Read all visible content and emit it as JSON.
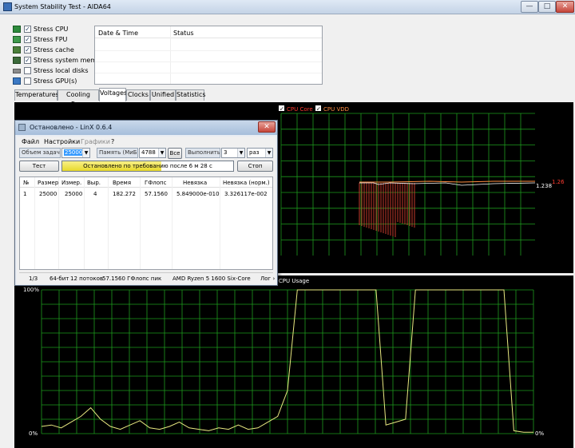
{
  "window": {
    "title": "System Stability Test - AIDA64",
    "minimize": "—",
    "maximize": "□",
    "close": "✕"
  },
  "stress_options": [
    {
      "label": "Stress CPU",
      "checked": true,
      "icon": "cpu-icon"
    },
    {
      "label": "Stress FPU",
      "checked": true,
      "icon": "fpu-icon"
    },
    {
      "label": "Stress cache",
      "checked": true,
      "icon": "cache-icon"
    },
    {
      "label": "Stress system memory",
      "checked": true,
      "icon": "memory-icon"
    },
    {
      "label": "Stress local disks",
      "checked": false,
      "icon": "disk-icon"
    },
    {
      "label": "Stress GPU(s)",
      "checked": false,
      "icon": "gpu-icon"
    }
  ],
  "log": {
    "columns": [
      "Date & Time",
      "Status"
    ]
  },
  "tabs": [
    "Temperatures",
    "Cooling Fans",
    "Voltages",
    "Clocks",
    "Unified",
    "Statistics"
  ],
  "active_tab": "Voltages",
  "voltage_chart": {
    "legend": [
      {
        "label": "CPU Core",
        "color": "#ff3b30",
        "checked": true
      },
      {
        "label": "CPU VDD",
        "color": "#ff8c40",
        "checked": true
      }
    ],
    "value_label_vdd": "1.238",
    "value_label_core": "1.26",
    "grid_color": "#1d9a1d"
  },
  "chart_data": {
    "type": "line",
    "title": "CPU Usage",
    "ytick_labels_left": [
      "100%",
      "0%"
    ],
    "ytick_labels_right": [
      "0%"
    ],
    "ylim": [
      0,
      100
    ],
    "x": [
      0,
      2,
      4,
      6,
      8,
      10,
      12,
      14,
      16,
      18,
      20,
      22,
      24,
      26,
      28,
      30,
      32,
      34,
      36,
      38,
      40,
      42,
      44,
      46,
      48,
      50,
      52,
      54,
      56,
      58,
      60,
      62,
      64,
      66,
      68,
      70,
      72,
      74,
      76,
      78,
      80,
      82,
      84,
      86,
      88,
      90,
      92,
      94,
      96,
      98,
      100
    ],
    "series": [
      {
        "values": [
          5,
          6,
          4,
          8,
          12,
          18,
          10,
          5,
          3,
          6,
          9,
          4,
          3,
          5,
          8,
          4,
          3,
          2,
          4,
          3,
          6,
          3,
          4,
          8,
          12,
          30,
          100,
          100,
          100,
          100,
          100,
          100,
          100,
          100,
          100,
          6,
          8,
          10,
          100,
          100,
          100,
          100,
          100,
          100,
          100,
          100,
          100,
          100,
          2,
          1,
          1
        ],
        "color": "#e8e880"
      }
    ],
    "grid": true
  },
  "linx": {
    "title": "Остановлено - LinX 0.6.4",
    "close": "✕",
    "menu": {
      "file": "Файл",
      "settings": "Настройки",
      "graphs": "Графики",
      "help": "?"
    },
    "problem_size_label": "Объем задачи:",
    "problem_size_value": "25000",
    "memory_label": "Память (MиБ):",
    "memory_value": "4788",
    "all_button": "Все",
    "run_label": "Выполнить:",
    "runs_value": "3",
    "runs_unit": "раз",
    "test_button": "Тест",
    "stop_button": "Стоп",
    "progress_text": "Остановлено по требованию после 6 м 28 с",
    "progress": 0.58,
    "results_columns": [
      "№",
      "Размер",
      "Измер.",
      "Выр.",
      "Время",
      "ГФлопс",
      "Невязка",
      "Невязка (норм.)"
    ],
    "results_rows": [
      [
        "1",
        "25000",
        "25000",
        "4",
        "182.272",
        "57.1560",
        "5.849000e-010",
        "3.326117e-002"
      ]
    ],
    "status": {
      "runs": "1/3",
      "bits": "64-бит",
      "threads": "12 потоков",
      "peak": "57.1560 ГФлопс пик",
      "cpu": "AMD Ryzen 5 1600 Six-Core",
      "log": "Лог ›"
    }
  }
}
